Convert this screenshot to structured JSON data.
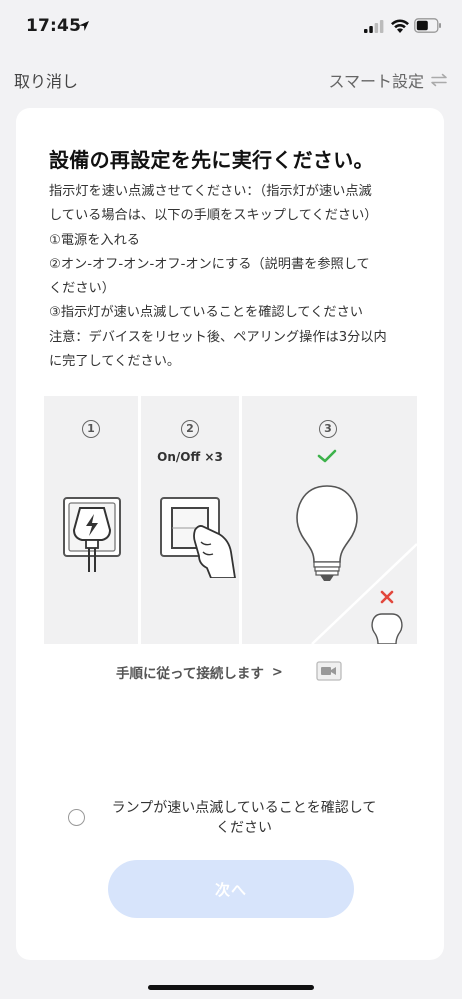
{
  "status_bar": {
    "time": "17:45",
    "icons": [
      "location-arrow-icon",
      "signal-icon",
      "wifi-icon",
      "battery-icon"
    ]
  },
  "nav": {
    "cancel_label": "取り消し",
    "smart_label": "スマート設定",
    "swap_icon": "swap-arrows-icon"
  },
  "content": {
    "title": "設備の再設定を先に実行ください。",
    "instructions": [
      "指示灯を速い点滅させてください：（指示灯が速い点滅",
      "している場合は、以下の手順をスキップしてください）",
      "①電源を入れる",
      "②オン-オフ-オン-オフ-オンにする（説明書を参照して",
      "ください）",
      "③指示灯が速い点滅していることを確認してください",
      "注意：デバイスをリセット後、ペアリング操作は3分以内",
      "に完了してください。"
    ]
  },
  "illustration": {
    "step1_number": "1",
    "step2_number": "2",
    "step2_caption": "On/Off ×3",
    "step3_number": "3",
    "icons": [
      "plug-power-icon",
      "wall-switch-icon",
      "bulb-flashing-icon",
      "check-icon",
      "cross-icon"
    ],
    "colors": {
      "check": "#3db24b",
      "cross": "#e2473c"
    }
  },
  "follow": {
    "label": "手順に従って接続します",
    "chevron": ">",
    "video_icon": "video-icon"
  },
  "confirm": {
    "text_line1": "ランプが速い点滅していることを確認して",
    "text_line2": "ください",
    "checked": false
  },
  "next_button": {
    "label": "次へ",
    "enabled": false,
    "color": "#d7e4fb"
  }
}
